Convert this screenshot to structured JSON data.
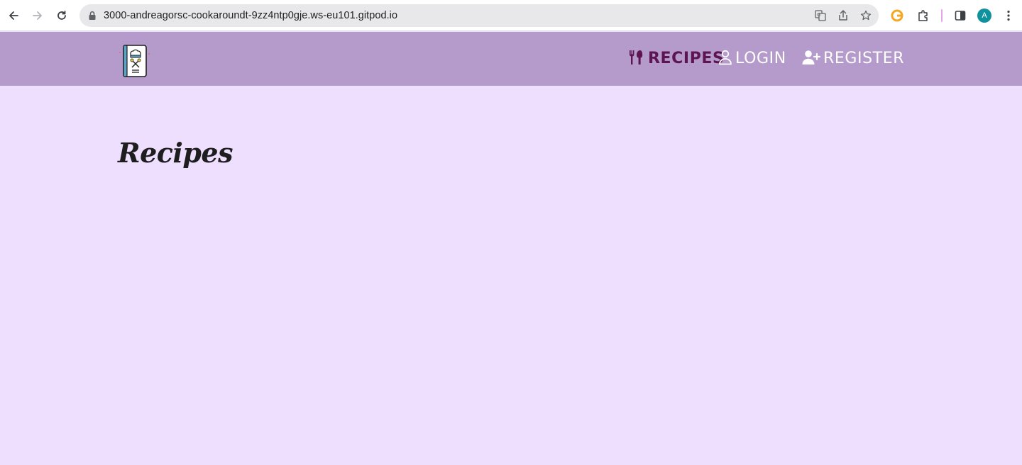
{
  "browser": {
    "url": "3000-andreagorsc-cookaroundt-9zz4ntp0gje.ws-eu101.gitpod.io",
    "profile_initial": "A",
    "icons": [
      "back-icon",
      "forward-icon",
      "reload-icon",
      "lock-icon",
      "translate-icon",
      "share-icon",
      "star-icon",
      "grammarly-icon",
      "extensions-icon",
      "side-panel-icon",
      "kebab-menu-icon"
    ],
    "colors": {
      "avatar": "#10929e",
      "separator": "#e6a4e6",
      "grammarly": "#f5a623"
    }
  },
  "site": {
    "logo_icon": "chef-cookbook-logo-icon",
    "nav": {
      "recipes": "Recipes",
      "login": "Login",
      "register": "Register"
    },
    "colors": {
      "header_bg": "#b59bcb",
      "page_bg": "#efdfff",
      "active_link": "#5d1550",
      "inactive_link": "#ffffff"
    }
  },
  "main": {
    "title": "Recipes"
  }
}
